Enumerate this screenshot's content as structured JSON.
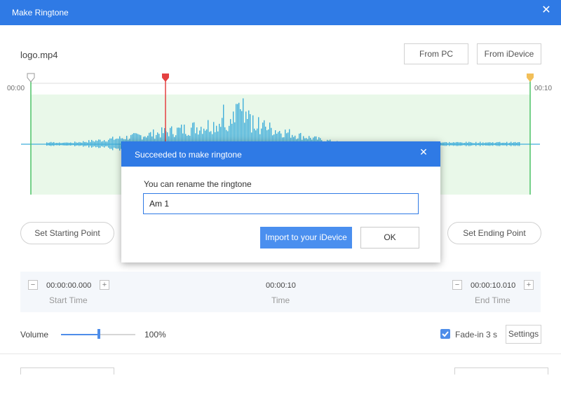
{
  "window": {
    "title": "Make Ringtone"
  },
  "file": {
    "name": "logo.mp4"
  },
  "source_buttons": {
    "from_pc": "From PC",
    "from_idevice": "From iDevice"
  },
  "waveform": {
    "start_time": "00:00",
    "end_time": "00:10",
    "selection_color": "#e6f7e6",
    "wave_color": "#1fa0d4"
  },
  "points": {
    "set_start": "Set Starting Point",
    "set_end": "Set Ending Point"
  },
  "times": {
    "start_value": "00:00:00.000",
    "start_label": "Start Time",
    "time_value": "00:00:10",
    "time_label": "Time",
    "end_value": "00:00:10.010",
    "end_label": "End Time",
    "minus": "−",
    "plus": "+"
  },
  "volume": {
    "label": "Volume",
    "percent_text": "100%",
    "level": 0.5
  },
  "fade": {
    "label": "Fade-in 3 s",
    "checked": true
  },
  "settings": {
    "label": "Settings"
  },
  "dialog": {
    "title": "Succeeded to make ringtone",
    "close": "✕",
    "prompt": "You can rename the ringtone",
    "input_value": "Am 1",
    "import_label": "Import to your iDevice",
    "ok_label": "OK"
  },
  "accent": "#2f7ae5"
}
